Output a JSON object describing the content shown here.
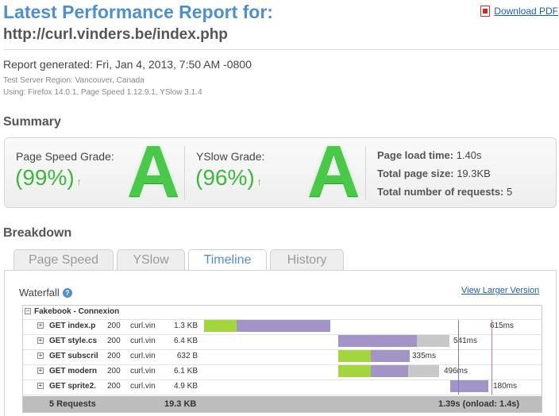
{
  "header": {
    "title": "Latest Performance Report for:",
    "url": "http://curl.vinders.be/index.php",
    "download_label": "Download PDF"
  },
  "report": {
    "generated": "Report generated: Fri, Jan 4, 2013, 7:50 AM -0800",
    "region": "Test Server Region: Vancouver, Canada",
    "using": "Using: Firefox 14.0.1, Page Speed 1.12.9.1, YSlow 3.1.4"
  },
  "summary": {
    "heading": "Summary",
    "pagespeed_label": "Page Speed Grade:",
    "pagespeed_pct": "(99%)",
    "pagespeed_grade": "A",
    "yslow_label": "YSlow Grade:",
    "yslow_pct": "(96%)",
    "yslow_grade": "A",
    "arrow": "↑",
    "load_time_label": "Page load time:",
    "load_time_value": "1.40s",
    "page_size_label": "Total page size:",
    "page_size_value": "19.3KB",
    "requests_label": "Total number of requests:",
    "requests_value": "5"
  },
  "breakdown": {
    "heading": "Breakdown",
    "tabs": [
      "Page Speed",
      "YSlow",
      "Timeline",
      "History"
    ],
    "active_tab": "Timeline"
  },
  "waterfall": {
    "title": "Waterfall",
    "help": "?",
    "larger_link": "View Larger Version",
    "group_label": "Fakebook - Connexion",
    "rows": [
      {
        "name": "GET index.p",
        "status": "200",
        "domain": "curl.vin",
        "size": "1.3 KB",
        "time": "615ms"
      },
      {
        "name": "GET style.cs",
        "status": "200",
        "domain": "curl.vin",
        "size": "6.4 KB",
        "time": "541ms"
      },
      {
        "name": "GET subscril",
        "status": "200",
        "domain": "curl.vin",
        "size": "632 B",
        "time": "335ms"
      },
      {
        "name": "GET modern",
        "status": "200",
        "domain": "curl.vin",
        "size": "6.1 KB",
        "time": "496ms"
      },
      {
        "name": "GET sprite2.",
        "status": "200",
        "domain": "curl.vin",
        "size": "4.9 KB",
        "time": "180ms"
      }
    ],
    "footer": {
      "requests": "5 Requests",
      "size": "19.3 KB",
      "time": "1.39s (onload: 1.4s)"
    },
    "colors": {
      "wait": "#a3d63c",
      "receive": "#a394c8",
      "gray": "#c8c8c8"
    }
  }
}
